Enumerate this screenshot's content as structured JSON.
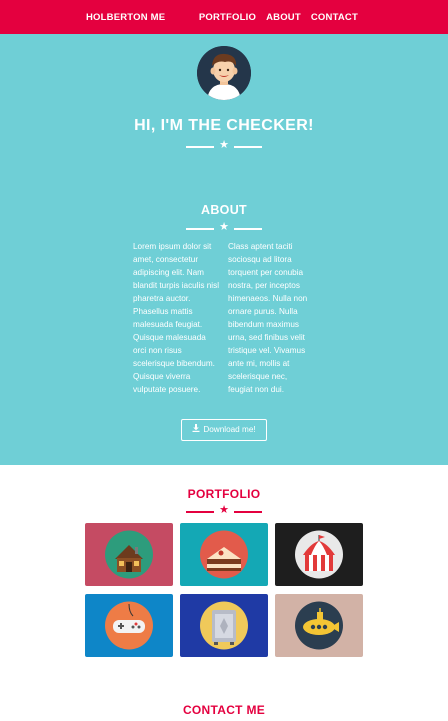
{
  "nav": {
    "brand": "HOLBERTON ME",
    "links": [
      "PORTFOLIO",
      "ABOUT",
      "CONTACT"
    ]
  },
  "hero": {
    "title": "HI, I'M THE CHECKER!"
  },
  "about": {
    "title": "ABOUT",
    "col1": "Lorem ipsum dolor sit amet, consectetur adipiscing elit. Nam blandit turpis iaculis nisl pharetra auctor. Phasellus mattis malesuada feugiat. Quisque malesuada orci non risus scelerisque bibendum. Quisque viverra vulputate posuere.",
    "col2": "Class aptent taciti sociosqu ad litora torquent per conubia nostra, per inceptos himenaeos. Nulla non ornare purus. Nulla bibendum maximus urna, sed finibus velit tristique vel. Vivamus ante mi, mollis at scelerisque nec, feugiat non dui.",
    "download_label": "Download me!"
  },
  "portfolio": {
    "title": "PORTFOLIO",
    "items": [
      {
        "icon": "cabin-icon",
        "bg": "#c54b63"
      },
      {
        "icon": "cake-icon",
        "bg": "#14a8b5"
      },
      {
        "icon": "circus-tent-icon",
        "bg": "#1e1e1e"
      },
      {
        "icon": "gamepad-icon",
        "bg": "#0e86c8"
      },
      {
        "icon": "safe-icon",
        "bg": "#1f3aa5"
      },
      {
        "icon": "submarine-icon",
        "bg": "#d2b2a6"
      }
    ]
  },
  "contact": {
    "title": "CONTACT ME"
  },
  "colors": {
    "accent": "#e4003f",
    "hero_bg": "#6fcfd6"
  }
}
